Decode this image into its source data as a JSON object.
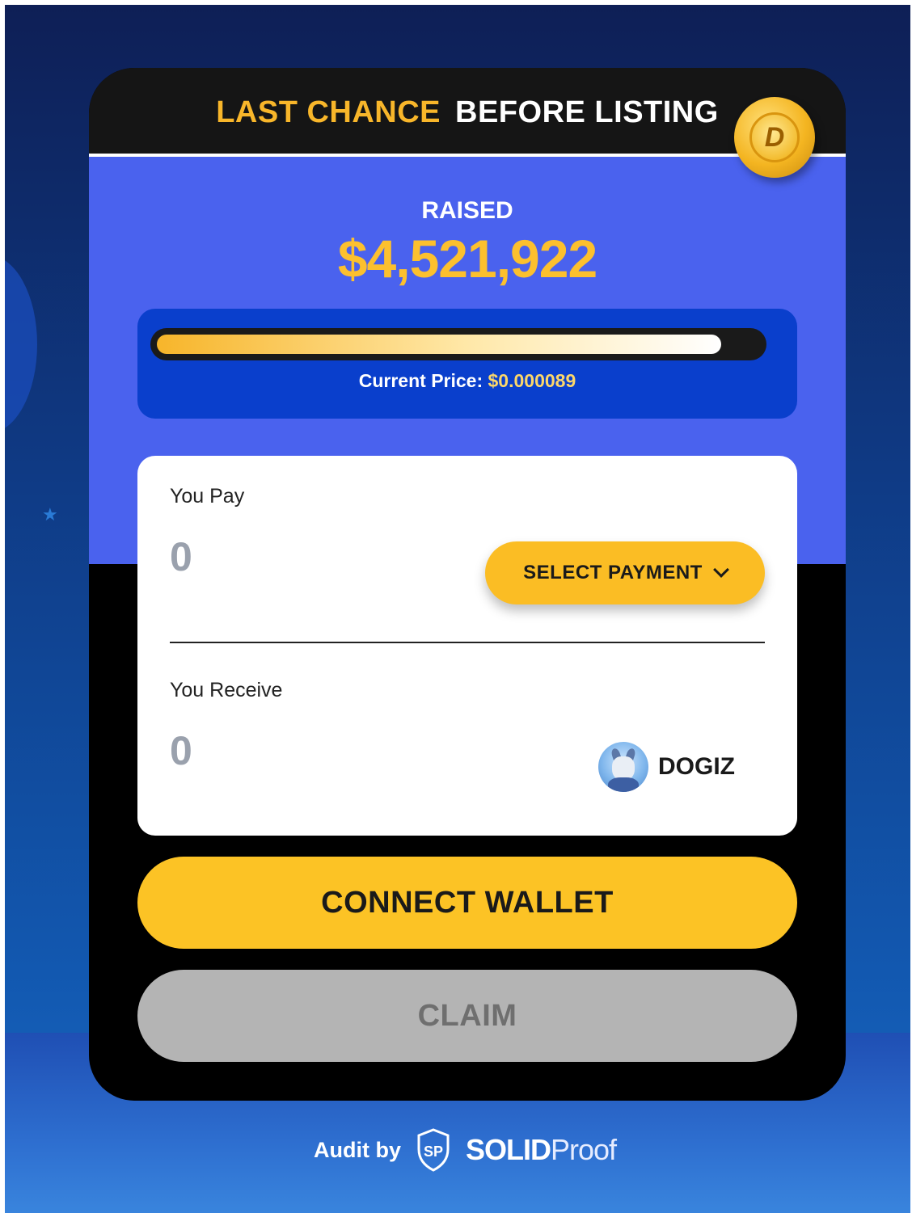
{
  "header": {
    "highlight": "LAST CHANCE",
    "rest": "BEFORE LISTING",
    "coin_letter": "D"
  },
  "raised": {
    "label": "RAISED",
    "value": "$4,521,922"
  },
  "progress": {
    "fraction": 0.935,
    "price_label": "Current Price:",
    "price_value": "$0.000089"
  },
  "pay": {
    "label": "You Pay",
    "placeholder": "0",
    "select_label": "SELECT PAYMENT"
  },
  "receive": {
    "label": "You Receive",
    "placeholder": "0",
    "token_name": "DOGIZ"
  },
  "buttons": {
    "connect": "CONNECT WALLET",
    "claim": "CLAIM"
  },
  "audit": {
    "prefix": "Audit by",
    "brand_bold": "SOLID",
    "brand_light": "Proof",
    "logo_letters": "SP"
  },
  "colors": {
    "accent_yellow": "#fcc325",
    "panel_blue": "#4a62ee",
    "claim_gray": "#b4b4b4"
  }
}
